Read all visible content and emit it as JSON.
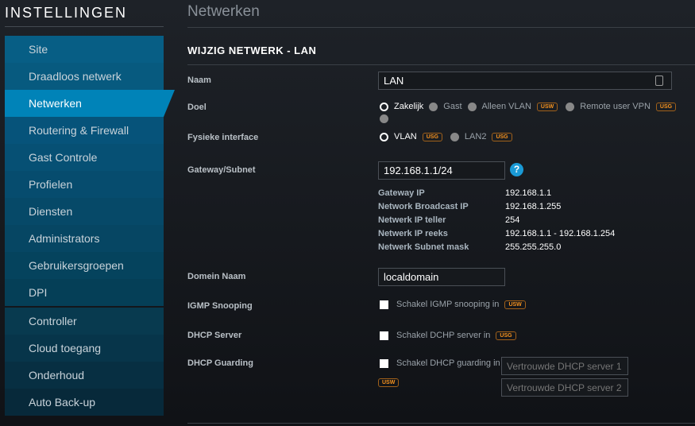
{
  "sidebar": {
    "title": "INSTELLINGEN",
    "groups": [
      [
        "Site",
        "Draadloos netwerk",
        "Netwerken",
        "Routering & Firewall",
        "Gast Controle",
        "Profielen",
        "Diensten",
        "Administrators",
        "Gebruikersgroepen",
        "DPI"
      ],
      [
        "Controller",
        "Cloud toegang",
        "Onderhoud",
        "Auto Back-up"
      ]
    ],
    "active": "Netwerken"
  },
  "main": {
    "title": "Netwerken",
    "section": "WIJZIG NETWERK - LAN",
    "naam": {
      "label": "Naam",
      "value": "LAN"
    },
    "doel": {
      "label": "Doel",
      "options": [
        "Zakelijk",
        "Gast",
        "Alleen VLAN",
        "Remote user VPN"
      ],
      "badges": [
        "USW",
        "USG"
      ]
    },
    "interface": {
      "label": "Fysieke interface",
      "options": [
        "VLAN",
        "LAN2"
      ],
      "badge": "USG"
    },
    "gateway": {
      "label": "Gateway/Subnet",
      "value": "192.168.1.1/24",
      "help": "?"
    },
    "info": [
      [
        "Gateway IP",
        "192.168.1.1"
      ],
      [
        "Network Broadcast IP",
        "192.168.1.255"
      ],
      [
        "Netwerk IP teller",
        "254"
      ],
      [
        "Netwerk IP reeks",
        "192.168.1.1 - 192.168.1.254"
      ],
      [
        "Netwerk Subnet mask",
        "255.255.255.0"
      ]
    ],
    "domein": {
      "label": "Domein Naam",
      "value": "localdomain"
    },
    "igmp": {
      "label": "IGMP Snooping",
      "text": "Schakel IGMP snooping in",
      "badge": "USW"
    },
    "dhcp": {
      "label": "DHCP Server",
      "text": "Schakel DCHP server in",
      "badge": "USG"
    },
    "guard": {
      "label": "DHCP Guarding",
      "text": "Schakel DHCP guarding in",
      "ph1": "Vertrouwde DHCP server 1",
      "ph2": "Vertrouwde DHCP server 2",
      "badge": "USW"
    }
  },
  "colors": {
    "accent": "#0083b8",
    "badge": "#f7931e"
  }
}
